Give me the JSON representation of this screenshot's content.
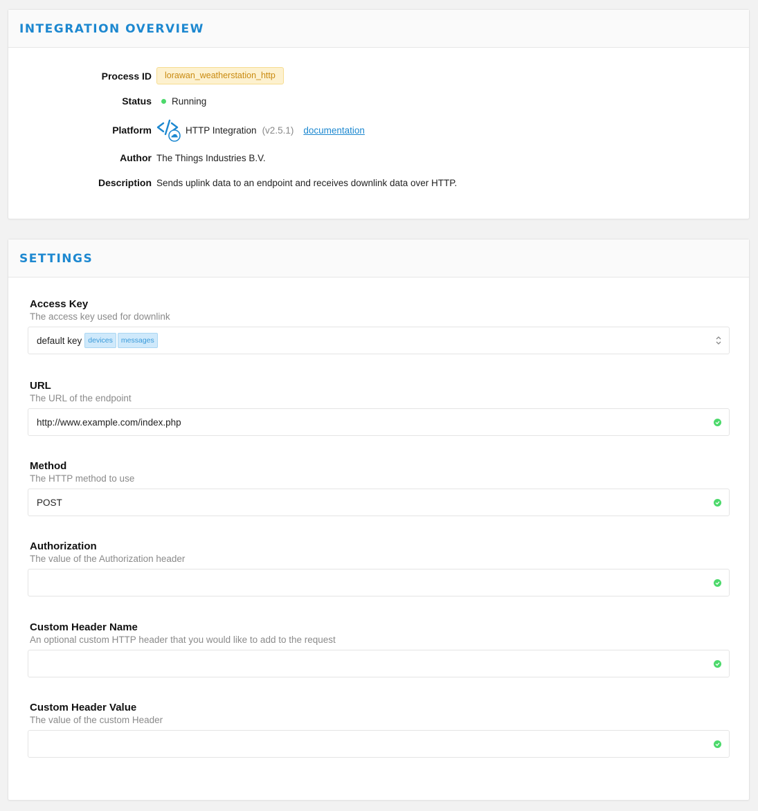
{
  "overview": {
    "title": "INTEGRATION OVERVIEW",
    "process_id_label": "Process ID",
    "process_id": "lorawan_weatherstation_http",
    "status_label": "Status",
    "status": "Running",
    "platform_label": "Platform",
    "platform_name": "HTTP Integration",
    "platform_version": "(v2.5.1)",
    "documentation_link": "documentation",
    "platform_icon": "http-integration-icon",
    "author_label": "Author",
    "author": "The Things Industries B.V.",
    "description_label": "Description",
    "description": "Sends uplink data to an endpoint and receives downlink data over HTTP."
  },
  "settings": {
    "title": "SETTINGS",
    "access_key": {
      "label": "Access Key",
      "description": "The access key used for downlink",
      "value": "default key",
      "tags": [
        "devices",
        "messages"
      ]
    },
    "url": {
      "label": "URL",
      "description": "The URL of the endpoint",
      "value": "http://www.example.com/index.php"
    },
    "method": {
      "label": "Method",
      "description": "The HTTP method to use",
      "value": "POST"
    },
    "authorization": {
      "label": "Authorization",
      "description": "The value of the Authorization header",
      "value": ""
    },
    "custom_header_name": {
      "label": "Custom Header Name",
      "description": "An optional custom HTTP header that you would like to add to the request",
      "value": ""
    },
    "custom_header_value": {
      "label": "Custom Header Value",
      "description": "The value of the custom Header",
      "value": ""
    }
  },
  "colors": {
    "accent": "#1d88d0",
    "success": "#4cd96b",
    "badge_bg": "#fdf1cf",
    "badge_text": "#c98a10"
  }
}
